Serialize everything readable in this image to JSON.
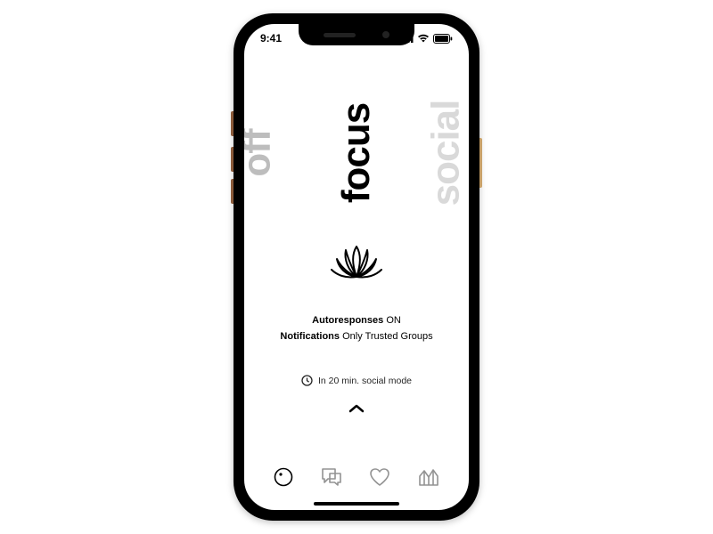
{
  "status": {
    "time": "9:41"
  },
  "modes": {
    "off": "off",
    "focus": "focus",
    "social": "social"
  },
  "settings": {
    "autoresponses_label": "Autoresponses",
    "autoresponses_value": "ON",
    "notifications_label": "Notifications",
    "notifications_value": "Only Trusted Groups"
  },
  "timer": {
    "text": "In 20 min. social mode"
  },
  "icons": {
    "lotus": "lotus-icon",
    "clock": "clock-icon",
    "chevron_up": "chevron-up-icon",
    "tab_mode": "mode-icon",
    "tab_chat": "chat-icon",
    "tab_heart": "heart-icon",
    "tab_stats": "stats-icon"
  }
}
